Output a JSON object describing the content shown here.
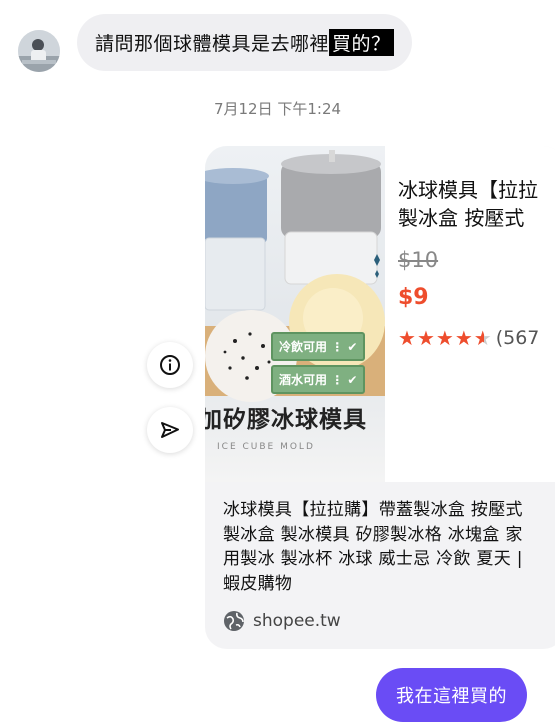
{
  "incoming_message": {
    "text_before": "請問那個球體模具是去哪裡",
    "text_highlight": "買的？"
  },
  "timestamp": "7月12日 下午1:24",
  "link_preview": {
    "image_title": "加矽膠冰球模具",
    "image_subtitle": "ICE CUBE MOLD",
    "image_tag_1": "冷飲可用",
    "image_tag_2": "酒水可用",
    "product_title_line1": "冰球模具【拉拉",
    "product_title_line2": "製冰盒 按壓式",
    "price_original": "$10",
    "price_current": "$9",
    "rating_stars": 4.5,
    "rating_count": "(567",
    "page_title": "冰球模具【拉拉購】帶蓋製冰盒 按壓式製冰盒 製冰模具 矽膠製冰格 冰塊盒 家用製冰 製冰杯 冰球 威士忌 冷飲 夏天 | 蝦皮購物",
    "domain": "shopee.tw"
  },
  "outgoing_message": {
    "text": "我在這裡買的"
  },
  "colors": {
    "incoming_bubble": "#efeff2",
    "outgoing_bubble": "#6a4cf5",
    "price_accent": "#ee4d2d",
    "card_background": "#f3f3f5"
  },
  "icons": [
    "avatar",
    "info-icon",
    "share-icon",
    "globe-icon",
    "star-icon"
  ]
}
